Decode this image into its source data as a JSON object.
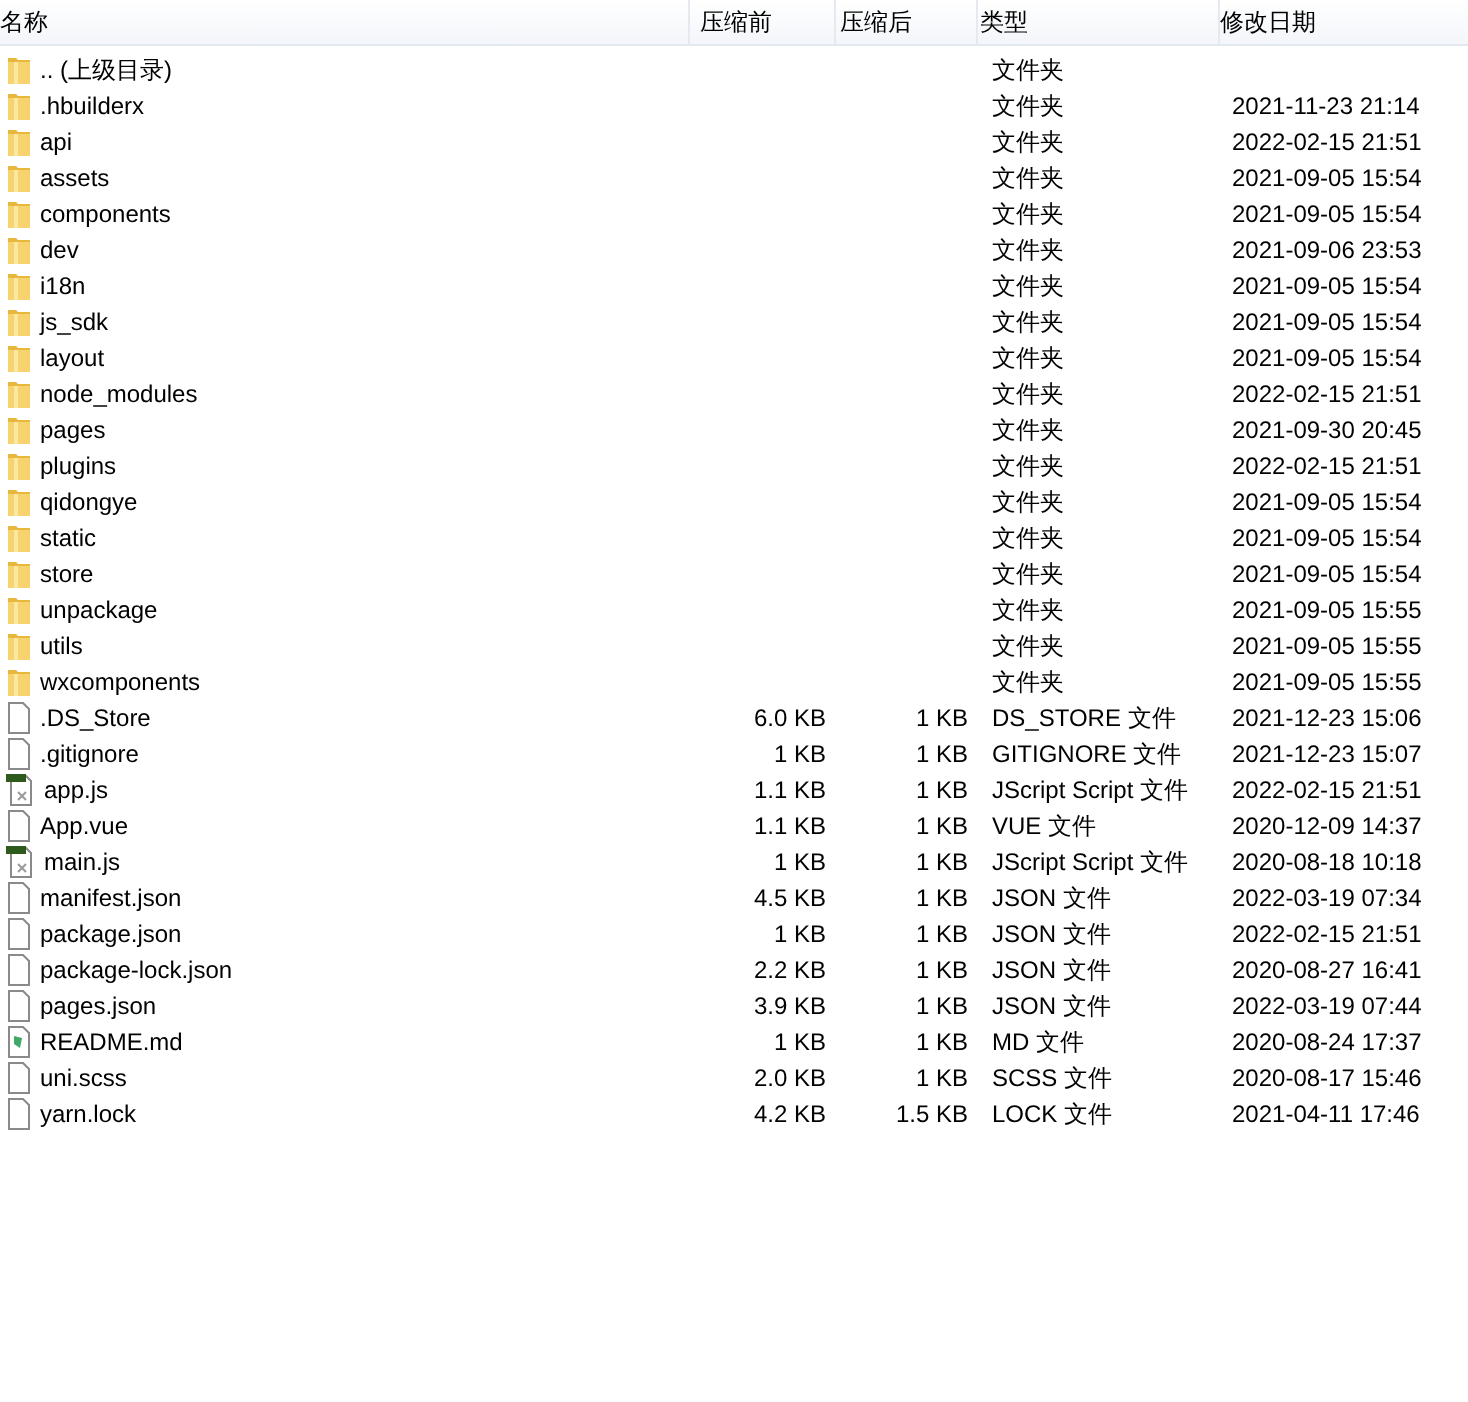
{
  "columns": [
    "名称",
    "压缩前",
    "压缩后",
    "类型",
    "修改日期"
  ],
  "rows": [
    {
      "kind": "folder",
      "name": ".. (上级目录)",
      "type": "文件夹"
    },
    {
      "kind": "folder",
      "name": ".hbuilderx",
      "type": "文件夹",
      "modified": "2021-11-23 21:14"
    },
    {
      "kind": "folder",
      "name": "api",
      "type": "文件夹",
      "modified": "2022-02-15 21:51"
    },
    {
      "kind": "folder",
      "name": "assets",
      "type": "文件夹",
      "modified": "2021-09-05 15:54"
    },
    {
      "kind": "folder",
      "name": "components",
      "type": "文件夹",
      "modified": "2021-09-05 15:54"
    },
    {
      "kind": "folder",
      "name": "dev",
      "type": "文件夹",
      "modified": "2021-09-06 23:53"
    },
    {
      "kind": "folder",
      "name": "i18n",
      "type": "文件夹",
      "modified": "2021-09-05 15:54"
    },
    {
      "kind": "folder",
      "name": "js_sdk",
      "type": "文件夹",
      "modified": "2021-09-05 15:54"
    },
    {
      "kind": "folder",
      "name": "layout",
      "type": "文件夹",
      "modified": "2021-09-05 15:54"
    },
    {
      "kind": "folder",
      "name": "node_modules",
      "type": "文件夹",
      "modified": "2022-02-15 21:51"
    },
    {
      "kind": "folder",
      "name": "pages",
      "type": "文件夹",
      "modified": "2021-09-30 20:45"
    },
    {
      "kind": "folder",
      "name": "plugins",
      "type": "文件夹",
      "modified": "2022-02-15 21:51"
    },
    {
      "kind": "folder",
      "name": "qidongye",
      "type": "文件夹",
      "modified": "2021-09-05 15:54"
    },
    {
      "kind": "folder",
      "name": "static",
      "type": "文件夹",
      "modified": "2021-09-05 15:54"
    },
    {
      "kind": "folder",
      "name": "store",
      "type": "文件夹",
      "modified": "2021-09-05 15:54"
    },
    {
      "kind": "folder",
      "name": "unpackage",
      "type": "文件夹",
      "modified": "2021-09-05 15:55"
    },
    {
      "kind": "folder",
      "name": "utils",
      "type": "文件夹",
      "modified": "2021-09-05 15:55"
    },
    {
      "kind": "folder",
      "name": "wxcomponents",
      "type": "文件夹",
      "modified": "2021-09-05 15:55"
    },
    {
      "kind": "file",
      "name": ".DS_Store",
      "before": "6.0 KB",
      "after": "1 KB",
      "type": "DS_STORE 文件",
      "modified": "2021-12-23 15:06"
    },
    {
      "kind": "file",
      "name": ".gitignore",
      "before": "1 KB",
      "after": "1 KB",
      "type": "GITIGNORE 文件",
      "modified": "2021-12-23 15:07"
    },
    {
      "kind": "script",
      "name": "app.js",
      "before": "1.1 KB",
      "after": "1 KB",
      "type": "JScript Script 文件",
      "modified": "2022-02-15 21:51"
    },
    {
      "kind": "file",
      "name": "App.vue",
      "before": "1.1 KB",
      "after": "1 KB",
      "type": "VUE 文件",
      "modified": "2020-12-09 14:37"
    },
    {
      "kind": "script",
      "name": "main.js",
      "before": "1 KB",
      "after": "1 KB",
      "type": "JScript Script 文件",
      "modified": "2020-08-18 10:18"
    },
    {
      "kind": "file",
      "name": "manifest.json",
      "before": "4.5 KB",
      "after": "1 KB",
      "type": "JSON 文件",
      "modified": "2022-03-19 07:34"
    },
    {
      "kind": "file",
      "name": "package.json",
      "before": "1 KB",
      "after": "1 KB",
      "type": "JSON 文件",
      "modified": "2022-02-15 21:51"
    },
    {
      "kind": "file",
      "name": "package-lock.json",
      "before": "2.2 KB",
      "after": "1 KB",
      "type": "JSON 文件",
      "modified": "2020-08-27 16:41"
    },
    {
      "kind": "file",
      "name": "pages.json",
      "before": "3.9 KB",
      "after": "1 KB",
      "type": "JSON 文件",
      "modified": "2022-03-19 07:44"
    },
    {
      "kind": "markdown",
      "name": "README.md",
      "before": "1 KB",
      "after": "1 KB",
      "type": "MD 文件",
      "modified": "2020-08-24 17:37"
    },
    {
      "kind": "file",
      "name": "uni.scss",
      "before": "2.0 KB",
      "after": "1 KB",
      "type": "SCSS 文件",
      "modified": "2020-08-17 15:46"
    },
    {
      "kind": "file",
      "name": "yarn.lock",
      "before": "4.2 KB",
      "after": "1.5 KB",
      "type": "LOCK 文件",
      "modified": "2021-04-11 17:46"
    }
  ]
}
